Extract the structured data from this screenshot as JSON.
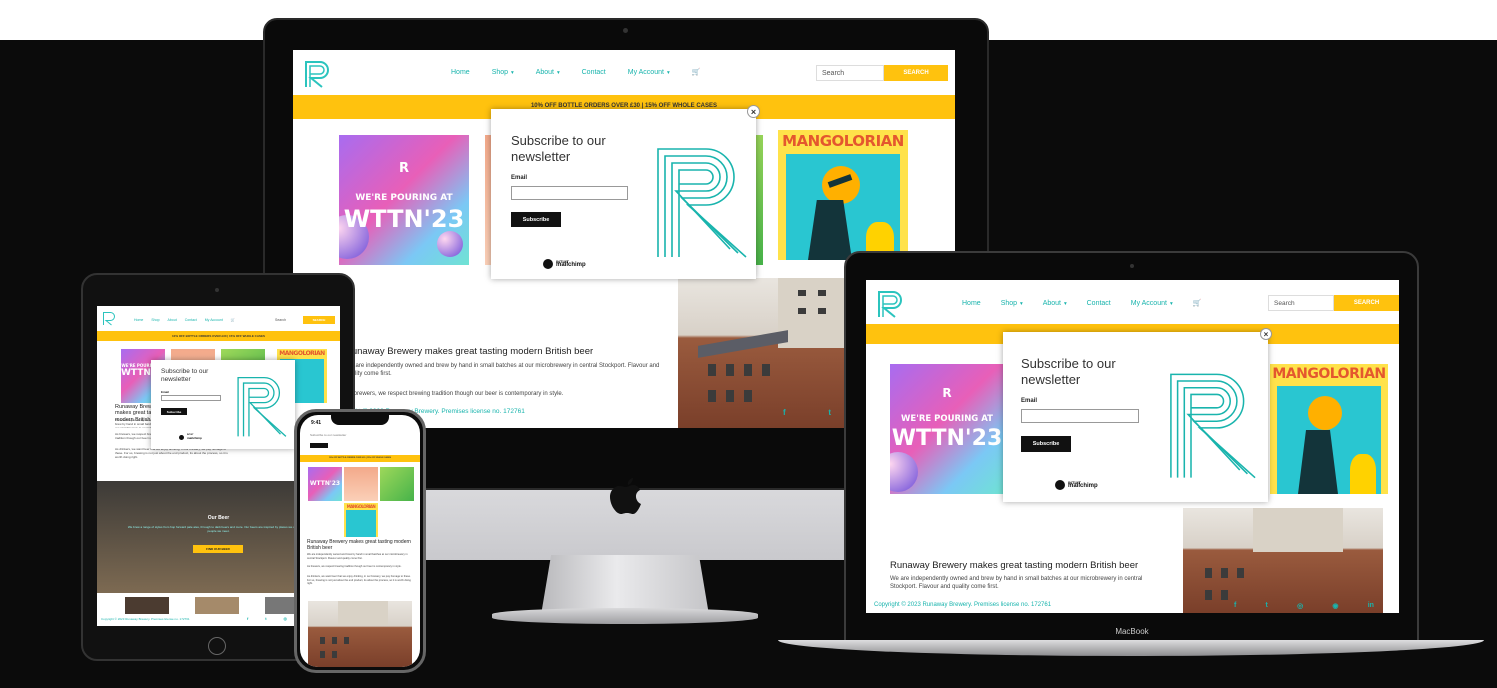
{
  "brand_logo": "R",
  "nav": {
    "home": "Home",
    "shop": "Shop",
    "about": "About",
    "contact": "Contact",
    "account": "My Account",
    "caret": "▾",
    "cart_icon": "cart-icon"
  },
  "search": {
    "placeholder": "Search",
    "button": "SEARCH"
  },
  "banner": "10% OFF BOTTLE ORDERS OVER £30 | 15% OFF WHOLE CASES",
  "tiles": {
    "pour_line1": "WE'RE POURING AT",
    "pour_line2": "WTTN'23",
    "mango": "MANGOLORIAN"
  },
  "modal": {
    "title": "Subscribe to our newsletter",
    "email_label": "Email",
    "subscribe_button": "Subscribe",
    "brand_small": "INTUIT",
    "brand_name": "mailchimp",
    "close": "×"
  },
  "about": {
    "heading": "Runaway Brewery makes great tasting modern British beer",
    "p1": "We are independently owned and brew by hand in small batches at our microbrewery in central Stockport. Flavour and quality come first.",
    "p2": "As brewers, we respect brewing tradition though our beer is contemporary in style.",
    "p3": "As drinkers, we want beer that we enjoy drinking, in our brewery, we pay homage to these. For us, brewing is not just about the end product, its about the process, so it is worth doing right."
  },
  "our_beer": {
    "title": "Our Beer",
    "text": "We brew a range of styles from hop forward pale ales, through to dark beers and more. Our beers are inspired by places we visit and the people we meet.",
    "button": "FIND OUR BEER"
  },
  "footer": {
    "copyright": "Copyright © 2023 Runaway Brewery. Premises license no. 172761",
    "social": [
      "f",
      "t",
      "◎",
      "◉",
      "in"
    ]
  },
  "devices": {
    "laptop_label": "MacBook",
    "phone_time": "9:41"
  },
  "colors": {
    "teal": "#19b4ad",
    "yellow": "#ffc20e",
    "black": "#111111"
  }
}
